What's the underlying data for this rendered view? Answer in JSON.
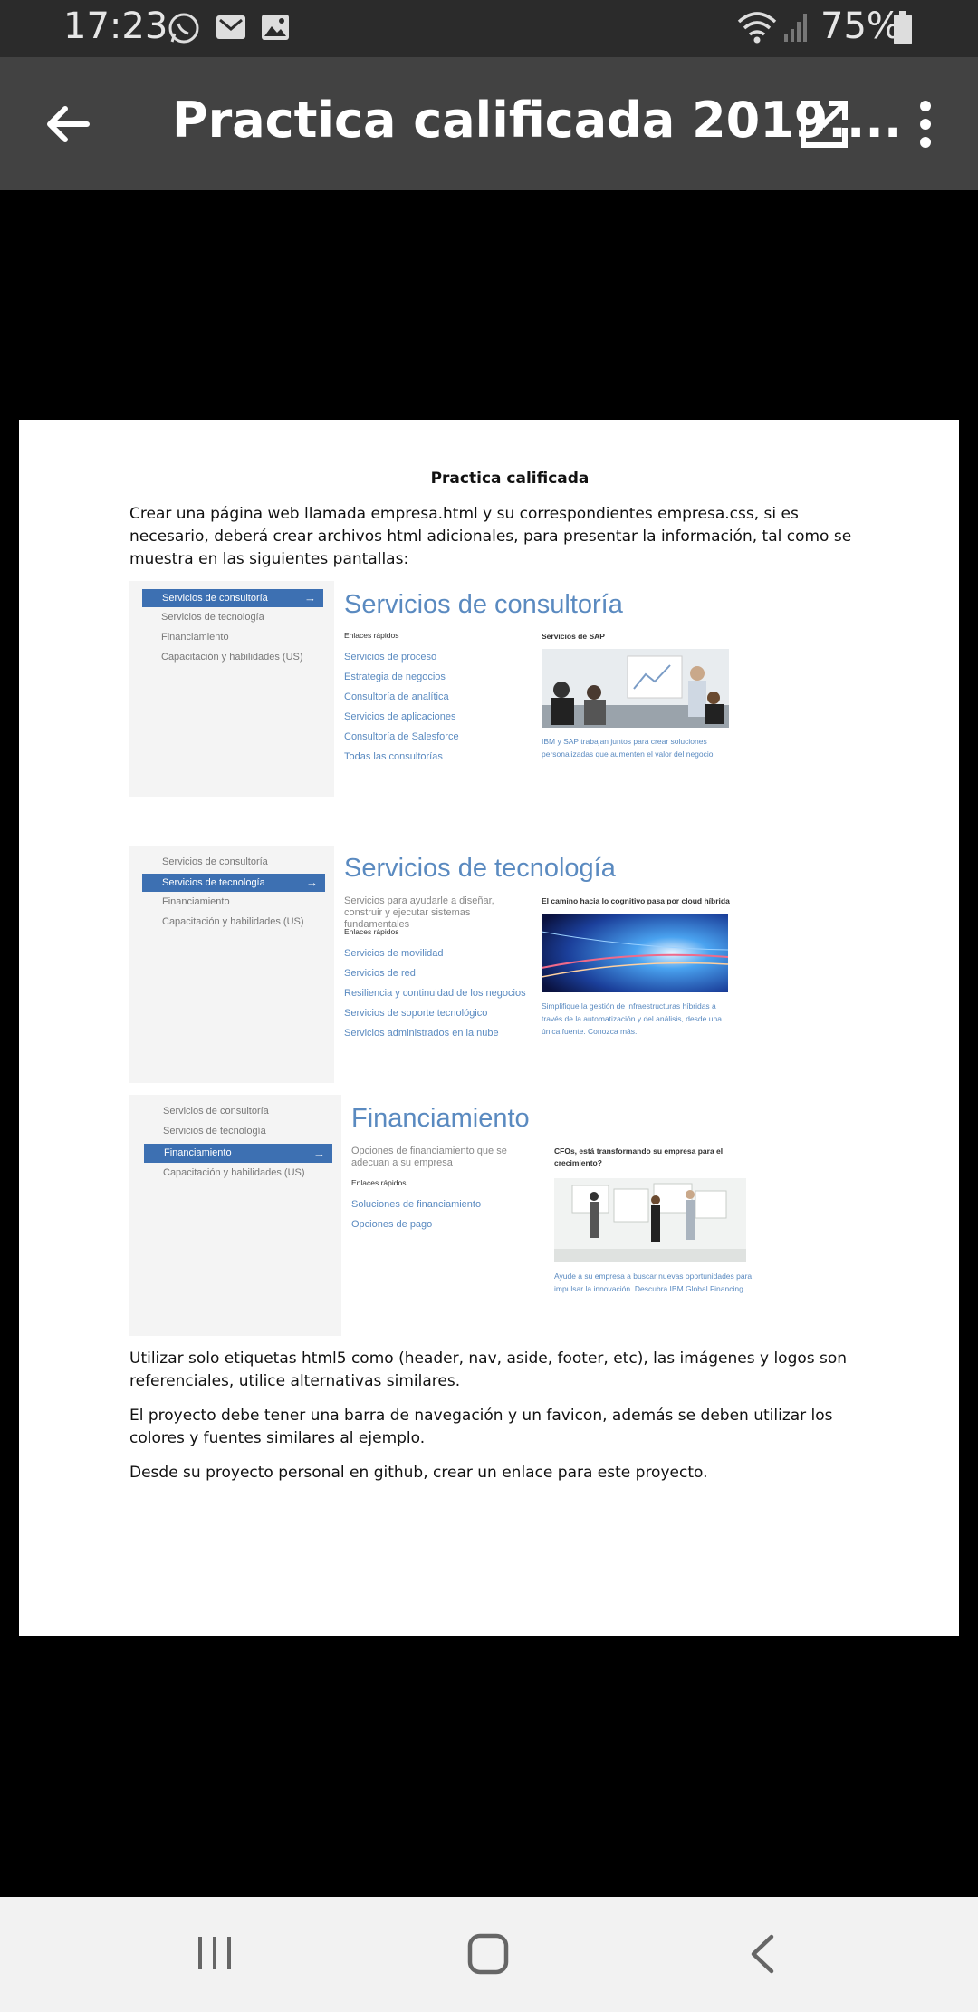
{
  "status_bar": {
    "time": "17:23",
    "battery": "75%",
    "icons": [
      "whatsapp-icon",
      "gmail-icon",
      "gallery-icon",
      "wifi-icon",
      "signal-icon",
      "battery-icon"
    ]
  },
  "app_bar": {
    "title": "Practica calificada 2019....",
    "icons": [
      "back-arrow-icon",
      "open-external-icon",
      "more-vert-icon"
    ]
  },
  "document": {
    "title": "Practica calificada",
    "intro": "Crear una página web llamada empresa.html y su correspondientes empresa.css, si es necesario, deberá crear archivos html adicionales, para presentar la información, tal como se muestra en las siguientes pantallas:",
    "p1": "Utilizar solo etiquetas html5 como (header, nav, aside, footer, etc), las imágenes y logos son referenciales, utilice alternativas similares.",
    "p2": "El proyecto debe tener una barra de navegación y un favicon, además se deben utilizar los colores y fuentes similares al ejemplo.",
    "p3": "Desde su proyecto personal en github, crear un enlace para este proyecto."
  },
  "menu": [
    "Servicios de consultoría",
    "Servicios de tecnología",
    "Financiamiento",
    "Capacitación y habilidades (US)"
  ],
  "shot1": {
    "heading": "Servicios de consultoría",
    "quick_links_label": "Enlaces rápidos",
    "links": [
      "Servicios de proceso",
      "Estrategia de negocios",
      "Consultoría de analítica",
      "Servicios de aplicaciones",
      "Consultoría de Salesforce",
      "Todas las consultorías"
    ],
    "card_title": "Servicios de SAP",
    "card_caption": "IBM y SAP trabajan juntos para crear soluciones personalizadas que aumenten el valor del negocio"
  },
  "shot2": {
    "heading": "Servicios de tecnología",
    "subtitle": "Servicios para ayudarle a diseñar, construir y ejecutar sistemas fundamentales",
    "quick_links_label": "Enlaces rápidos",
    "links": [
      "Servicios de movilidad",
      "Servicios de red",
      "Resiliencia y continuidad de los negocios",
      "Servicios de soporte tecnológico",
      "Servicios administrados en la nube"
    ],
    "card_title": "El camino hacia lo cognitivo pasa por cloud híbrida",
    "card_caption": "Simplifique la gestión de infraestructuras híbridas a través de la automatización y del análisis, desde una única fuente. Conozca más."
  },
  "shot3": {
    "heading": "Financiamiento",
    "subtitle": "Opciones de financiamiento que se adecuan a su empresa",
    "quick_links_label": "Enlaces rápidos",
    "links": [
      "Soluciones de financiamiento",
      "Opciones de pago"
    ],
    "card_title": "CFOs, está transformando su empresa para el crecimiento?",
    "card_caption": "Ayude a su empresa a buscar nuevas oportunidades para impulsar la innovación. Descubra IBM Global Financing."
  },
  "nav_bar": {
    "icons": [
      "recent-apps-icon",
      "home-icon",
      "back-icon"
    ]
  }
}
